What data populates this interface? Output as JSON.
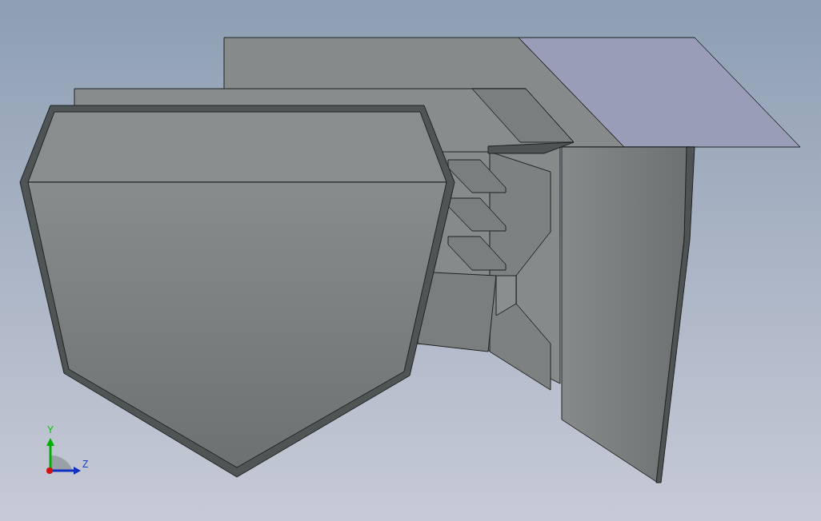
{
  "triad": {
    "labels": [
      "Y",
      "Z"
    ]
  }
}
